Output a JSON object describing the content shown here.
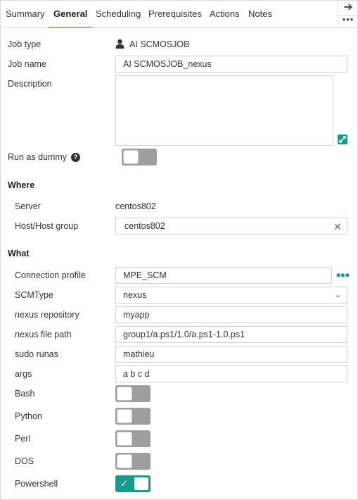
{
  "tabs": [
    "Summary",
    "General",
    "Scheduling",
    "Prerequisites",
    "Actions",
    "Notes"
  ],
  "active_tab": "General",
  "side": {
    "arrow_icon": "arrow-right-icon",
    "more_icon": "more-icon"
  },
  "general": {
    "job_type_label": "Job type",
    "job_type_value": "AI SCMOSJOB",
    "job_name_label": "Job name",
    "job_name_value": "AI SCMOSJOB_nexus",
    "description_label": "Description",
    "description_value": "",
    "run_as_dummy_label": "Run as dummy",
    "run_as_dummy_on": false
  },
  "where": {
    "title": "Where",
    "server_label": "Server",
    "server_value": "centos802",
    "host_label": "Host/Host group",
    "host_value": "centos802"
  },
  "what": {
    "title": "What",
    "connection_profile_label": "Connection profile",
    "connection_profile_value": "MPE_SCM",
    "scmtype_label": "SCMType",
    "scmtype_value": "nexus",
    "nexus_repository_label": "nexus repository",
    "nexus_repository_value": "myapp",
    "nexus_file_path_label": "nexus file path",
    "nexus_file_path_value": "group1/a.ps1/1.0/a.ps1-1.0.ps1",
    "sudo_runas_label": "sudo runas",
    "sudo_runas_value": "mathieu",
    "args_label": "args",
    "args_value": "a b c d",
    "bash_label": "Bash",
    "bash_on": false,
    "python_label": "Python",
    "python_on": false,
    "perl_label": "Perl",
    "perl_on": false,
    "dos_label": "DOS",
    "dos_on": false,
    "powershell_label": "Powershell",
    "powershell_on": true
  },
  "colors": {
    "accent": "#1a9a8a",
    "tab_underline": "#e8a033",
    "toggle_off": "#9e9e9e"
  }
}
